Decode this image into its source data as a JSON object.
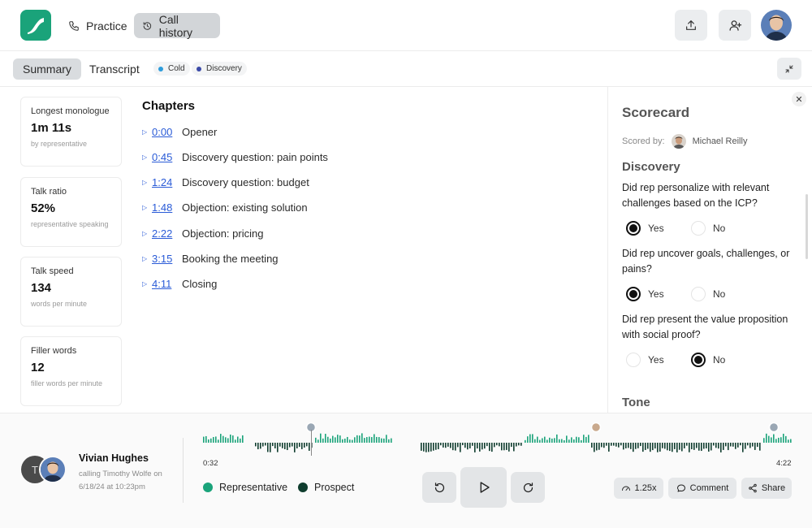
{
  "nav": {
    "practice_label": "Practice",
    "history_label": "Call history"
  },
  "subnav": {
    "summary_label": "Summary",
    "transcript_label": "Transcript",
    "tags": [
      {
        "label": "Cold",
        "color": "#2d9cdb"
      },
      {
        "label": "Discovery",
        "color": "#3b4aa8"
      }
    ]
  },
  "stats": [
    {
      "label": "Longest monologue",
      "value": "1m 11s",
      "sub": "by representative"
    },
    {
      "label": "Talk ratio",
      "value": "52%",
      "sub": "representative speaking"
    },
    {
      "label": "Talk speed",
      "value": "134",
      "sub": "words per minute"
    },
    {
      "label": "Filler words",
      "value": "12",
      "sub": "filler words per minute"
    }
  ],
  "chapters": {
    "title": "Chapters",
    "items": [
      {
        "time": "0:00",
        "label": "Opener"
      },
      {
        "time": "0:45",
        "label": "Discovery question: pain points"
      },
      {
        "time": "1:24",
        "label": "Discovery question: budget"
      },
      {
        "time": "1:48",
        "label": "Objection: existing solution"
      },
      {
        "time": "2:22",
        "label": "Objection: pricing"
      },
      {
        "time": "3:15",
        "label": "Booking the meeting"
      },
      {
        "time": "4:11",
        "label": "Closing"
      }
    ]
  },
  "scorecard": {
    "title": "Scorecard",
    "scored_by_label": "Scored by:",
    "scorer": "Michael Reilly",
    "sections": [
      {
        "title": "Discovery",
        "questions": [
          {
            "text": "Did rep personalize with relevant challenges based on the ICP?",
            "answer": "Yes"
          },
          {
            "text": "Did rep uncover goals, challenges, or pains?",
            "answer": "Yes"
          },
          {
            "text": "Did rep present the value proposition with social proof?",
            "answer": "No"
          }
        ]
      },
      {
        "title": "Tone",
        "questions": []
      }
    ],
    "yes_label": "Yes",
    "no_label": "No"
  },
  "player": {
    "rep_name": "Vivian Hughes",
    "call_info": "calling Timothy Wolfe on 6/18/24 at 10:23pm",
    "prospect_initial": "T",
    "time_start": "0:32",
    "time_end": "4:22",
    "legend": [
      {
        "label": "Representative",
        "color": "#1aa37a"
      },
      {
        "label": "Prospect",
        "color": "#0f3d2e"
      }
    ],
    "speed_label": "1.25x",
    "comment_label": "Comment",
    "share_label": "Share"
  },
  "colors": {
    "brand": "#1aa37a",
    "link": "#2a5bd7",
    "prospect": "#0f3d2e"
  }
}
